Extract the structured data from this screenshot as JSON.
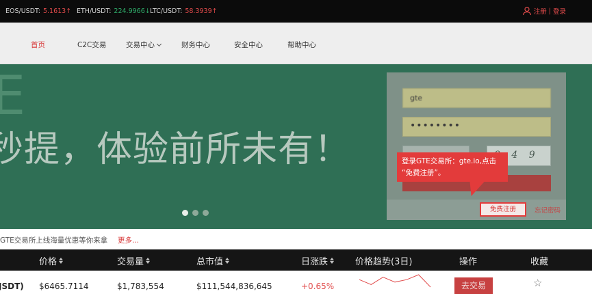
{
  "ticker": [
    {
      "pair": "EOS/USDT:",
      "price": "5.1613",
      "dir": "↑",
      "trend": "up"
    },
    {
      "pair": "ETH/USDT:",
      "price": "224.9966",
      "dir": "↓",
      "trend": "down"
    },
    {
      "pair": "LTC/USDT:",
      "price": "58.3939",
      "dir": "↑",
      "trend": "up"
    }
  ],
  "auth": {
    "register": "注册",
    "separator": " | ",
    "login": "登录"
  },
  "nav": [
    {
      "label": "首页",
      "active": true
    },
    {
      "label": "C2C交易"
    },
    {
      "label": "交易中心"
    },
    {
      "label": "财务中心"
    },
    {
      "label": "安全中心"
    },
    {
      "label": "帮助中心"
    }
  ],
  "banner": {
    "brand_fragment": "E",
    "slogan": "秒提，体验前所未有！"
  },
  "login": {
    "username_value": "gte",
    "password_value": "••••••••",
    "captcha_text": "8 4 9",
    "submit_label": "登",
    "register_link": "免费注册",
    "forgot_link": "忘记密码"
  },
  "tooltip": {
    "line1": "登录GTE交易所：gte.io,点击",
    "line2": "“免费注册”。"
  },
  "announcement": {
    "text": "GTE交易所上线海量优惠等你来拿",
    "more": "更多..."
  },
  "table": {
    "headers": {
      "price": "价格",
      "volume": "交易量",
      "market_cap": "总市值",
      "change": "日涨跌",
      "trend": "价格趋势(3日)",
      "action": "操作",
      "favorite": "收藏"
    },
    "rows": [
      {
        "pair_fragment": "JSDT)",
        "price": "$6465.7114",
        "volume": "$1,783,554",
        "market_cap": "$111,544,836,645",
        "change": "+0.65%",
        "action": "去交易",
        "trend_points": [
          1.0,
          0.98,
          1.01,
          0.99,
          1.0,
          1.02,
          0.97
        ]
      }
    ]
  },
  "colors": {
    "accent_red": "#e33b3b",
    "banner_green": "#2f6f55",
    "dark_bar": "#0b0b0b"
  }
}
